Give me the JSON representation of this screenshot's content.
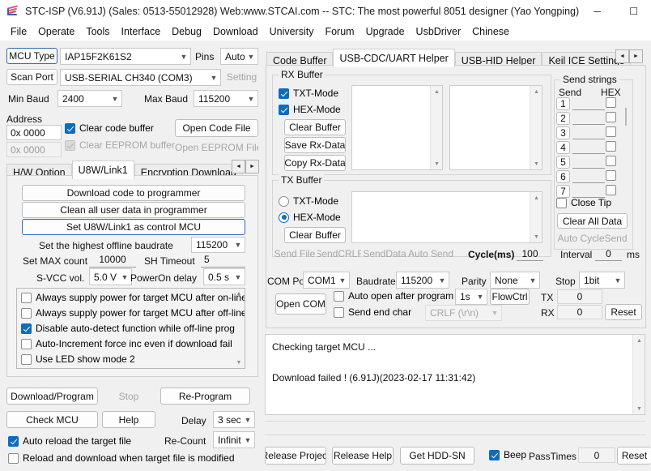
{
  "window": {
    "title": "STC-ISP (V6.91J) (Sales: 0513-55012928) Web:www.STCAI.com  -- STC: The most powerful 8051 designer (Yao Yongping)",
    "icon": "stc-logo-icon",
    "minimize": "─",
    "maximize": "☐",
    "close": "✕"
  },
  "menubar": {
    "items": [
      {
        "label": "File"
      },
      {
        "label": "Operate"
      },
      {
        "label": "Tools"
      },
      {
        "label": "Interface"
      },
      {
        "label": "Debug"
      },
      {
        "label": "Download"
      },
      {
        "label": "University"
      },
      {
        "label": "Forum"
      },
      {
        "label": "Upgrade"
      },
      {
        "label": "UsbDriver"
      },
      {
        "label": "Chinese"
      }
    ]
  },
  "left": {
    "mcu_type_label": "MCU Type",
    "mcu_type_value": "IAP15F2K61S2",
    "pins_label": "Pins",
    "pins_value": "Auto",
    "scan_port_label": "Scan Port",
    "scan_port_value": "USB-SERIAL CH340 (COM3)",
    "setting_button": "Setting",
    "min_baud_label": "Min Baud",
    "min_baud_value": "2400",
    "max_baud_label": "Max Baud",
    "max_baud_value": "115200",
    "address_label": "Address",
    "code_addr_value": "0x 0000",
    "eeprom_addr_value": "0x 0000",
    "clear_code_buffer": "Clear code buffer",
    "clear_eeprom_buffer": "Clear EEPROM buffer",
    "open_code_file": "Open Code File",
    "open_eeprom_file": "Open EEPROM File",
    "tabs": [
      {
        "label": "H/W Option",
        "selected": false
      },
      {
        "label": "U8W/Link1",
        "selected": true
      },
      {
        "label": "Encryption Download",
        "selected": false
      }
    ],
    "tab_prev": "◄",
    "tab_next": "►",
    "u8w": {
      "download_code": "Download code to programmer",
      "clean_user_data": "Clean all user data in programmer",
      "set_control_mcu": "Set U8W/Link1 as control MCU",
      "offline_baudrate_label": "Set the highest offline baudrate",
      "offline_baudrate_value": "115200",
      "max_count_label": "Set MAX count",
      "max_count_value": "10000",
      "sh_timeout_label": "SH Timeout",
      "sh_timeout_value": "5",
      "svcc_label": "S-VCC vol.",
      "svcc_value": "5.0 V",
      "poweron_delay_label": "PowerOn delay",
      "poweron_delay_value": "0.5 s",
      "options": [
        {
          "label": "Always supply power for target MCU after on-line",
          "checked": false
        },
        {
          "label": "Always supply power for target MCU after off-line",
          "checked": false
        },
        {
          "label": "Disable auto-detect function while off-line prog",
          "checked": true
        },
        {
          "label": "Auto-Increment force inc even if download fail",
          "checked": false
        },
        {
          "label": "Use LED show mode 2",
          "checked": false
        }
      ],
      "scroll_up": "▲",
      "scroll_down": "▼"
    },
    "actions": {
      "download_program": "Download/Program",
      "stop": "Stop",
      "re_program": "Re-Program",
      "check_mcu": "Check MCU",
      "help": "Help",
      "delay_label": "Delay",
      "delay_value": "3 sec",
      "recount_label": "Re-Count",
      "recount_value": "Infinite",
      "auto_reload": "Auto reload the target file",
      "auto_reload_checked": true,
      "reload_modified": "Reload and download when target file is modified",
      "reload_modified_checked": false
    }
  },
  "right": {
    "tabs": [
      {
        "label": "Code Buffer",
        "selected": false
      },
      {
        "label": "USB-CDC/UART Helper",
        "selected": true
      },
      {
        "label": "USB-HID Helper",
        "selected": false
      },
      {
        "label": "Keil ICE Settings",
        "selected": false
      }
    ],
    "tab_prev": "◄",
    "tab_next": "►",
    "rx": {
      "group_title": "RX Buffer",
      "txt_mode": "TXT-Mode",
      "txt_mode_checked": true,
      "hex_mode": "HEX-Mode",
      "hex_mode_checked": true,
      "clear_buffer": "Clear Buffer",
      "save_rx_data": "Save Rx-Data",
      "copy_rx_data": "Copy Rx-Data",
      "text_left": "",
      "text_right": ""
    },
    "tx": {
      "group_title": "TX Buffer",
      "txt_mode": "TXT-Mode",
      "txt_mode_selected": false,
      "hex_mode": "HEX-Mode",
      "hex_mode_selected": true,
      "clear_buffer": "Clear Buffer",
      "text": "",
      "send_file": "Send File",
      "send_crlf": "SendCRLF",
      "send_data": "SendData",
      "auto_send": "Auto Send",
      "cycle_label": "Cycle(ms)",
      "cycle_value": "100"
    },
    "send_strings": {
      "group_title": "Send strings",
      "send_header": "Send",
      "hex_header": "HEX",
      "rows": [
        {
          "num": "1",
          "value": "",
          "hex": false
        },
        {
          "num": "2",
          "value": "",
          "hex": false
        },
        {
          "num": "3",
          "value": "",
          "hex": false
        },
        {
          "num": "4",
          "value": "",
          "hex": false
        },
        {
          "num": "5",
          "value": "",
          "hex": false
        },
        {
          "num": "6",
          "value": "",
          "hex": false
        },
        {
          "num": "7",
          "value": "",
          "hex": false
        }
      ],
      "close_tip": "Close Tip",
      "close_tip_checked": false,
      "clear_all_data": "Clear All Data",
      "auto_cycle_send": "Auto CycleSend",
      "interval_label": "Interval",
      "interval_value": "0",
      "interval_unit": "ms"
    },
    "comport": {
      "port_label": "COM Port",
      "port_value": "COM1",
      "baudrate_label": "Baudrate",
      "baudrate_value": "115200",
      "parity_label": "Parity",
      "parity_value": "None",
      "stop_label": "Stop",
      "stop_value": "1bit",
      "open_com": "Open COM",
      "auto_open": "Auto open after program",
      "auto_open_checked": false,
      "auto_open_delay": "1s",
      "flowctrl": "FlowCtrl",
      "send_end_char": "Send end char",
      "send_end_char_checked": false,
      "end_char_value": "CRLF (\\r\\n)",
      "tx_label": "TX",
      "tx_value": "0",
      "rx_label": "RX",
      "rx_value": "0",
      "reset": "Reset"
    },
    "log": {
      "lines": [
        "Checking target MCU ...",
        "",
        "Download failed ! (6.91J)(2023-02-17 11:31:42)"
      ],
      "scroll_up": "▲",
      "scroll_down": "▼",
      "progress_value": ""
    },
    "bottombar": {
      "release_project": "Release Project",
      "release_help": "Release Help",
      "get_hdd_sn": "Get HDD-SN",
      "beep": "Beep",
      "beep_checked": true,
      "passtimes_label": "PassTimes",
      "passtimes_value": "0",
      "reset": "Reset"
    }
  },
  "colors": {
    "accent": "#0f6cbd",
    "window_bg": "#f0f0f0",
    "titlebar_bg": "#ffffff",
    "field_bg": "#ffffff",
    "disabled_text": "#a6a6a6"
  }
}
